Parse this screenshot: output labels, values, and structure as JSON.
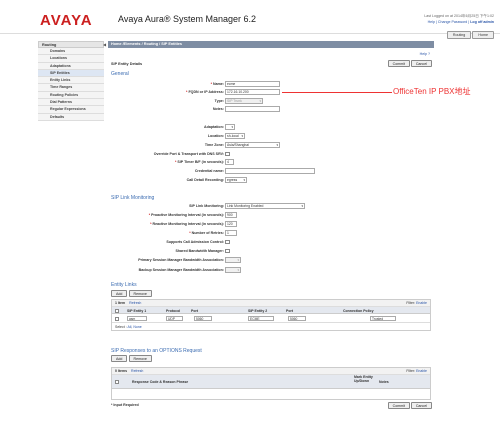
{
  "header": {
    "logo": "AVAYA",
    "app_title": "Avaya Aura® System Manager 6.2",
    "last_logged": "Last Logged on at 2014年6月25日 下午1:02",
    "help_link": "Help",
    "change_password_link": "Change Password",
    "logout_link": "Log off admin",
    "routing_button": "Routing",
    "home_button": "Home",
    "sep1": "|",
    "sep2": "|"
  },
  "nav": {
    "header": "Routing",
    "collapse_glyph": "◀",
    "items": [
      {
        "label": "Domains"
      },
      {
        "label": "Locations"
      },
      {
        "label": "Adaptations"
      },
      {
        "label": "SIP Entities"
      },
      {
        "label": "Entity Links"
      },
      {
        "label": "Time Ranges"
      },
      {
        "label": "Routing Policies"
      },
      {
        "label": "Dial Patterns"
      },
      {
        "label": "Regular Expressions"
      },
      {
        "label": "Defaults"
      }
    ]
  },
  "main": {
    "breadcrumb": "Home /Elements / Routing / SIP Entities",
    "help": "Help ?",
    "commit": "Commit",
    "cancel": "Cancel",
    "subtitle": "SIP Entity Details",
    "general_title": "General",
    "fields": {
      "name": {
        "label": "Name:",
        "value": "ecme"
      },
      "fqdn": {
        "label": "FQDN or IP Address:",
        "value": "172.16.10.200"
      },
      "type": {
        "label": "Type:",
        "value": "SIP Trunk"
      },
      "notes": {
        "label": "Notes:",
        "value": ""
      },
      "adaptation": {
        "label": "Adaptation:",
        "value": ""
      },
      "location": {
        "label": "Location:",
        "value": "sh-local"
      },
      "time_zone": {
        "label": "Time Zone:",
        "value": "Asia/Shanghai"
      },
      "override_port": {
        "label": "Override Port & Transport with DNS SRV:"
      },
      "sip_timer": {
        "label": "SIP Timer B/F (in seconds):",
        "value": "4"
      },
      "credential": {
        "label": "Credential name:",
        "value": ""
      },
      "call_detail": {
        "label": "Call Detail Recording:",
        "value": "egress"
      }
    },
    "required_mark": "*",
    "sip_link_title": "SIP Link Monitoring",
    "link_fields": {
      "monitoring": {
        "label": "SIP Link Monitoring:",
        "value": "Link Monitoring Enabled"
      },
      "proactive": {
        "label": "Proactive Monitoring Interval (in seconds):",
        "value": "900"
      },
      "reactive": {
        "label": "Reactive Monitoring Interval (in seconds):",
        "value": "120"
      },
      "retries": {
        "label": "Number of Retries:",
        "value": "1"
      },
      "cac": {
        "label": "Supports Call Admission Control:"
      },
      "shared_bw": {
        "label": "Shared Bandwidth Manager:"
      },
      "primary_bw": {
        "label": "Primary Session Manager Bandwidth Association:",
        "value": ""
      },
      "backup_bw": {
        "label": "Backup Session Manager Bandwidth Association:",
        "value": ""
      }
    },
    "entity_links": {
      "title": "Entity Links",
      "add": "Add",
      "remove": "Remove",
      "count": "1 Item",
      "refresh": "Refresh",
      "filter_label": "Filter:",
      "filter_link": "Enable",
      "columns": [
        "SIP Entity 1",
        "Protocol",
        "Port",
        "SIP Entity 2",
        "Port",
        "Connection Policy"
      ],
      "row": {
        "entity1": "asm",
        "protocol": "UDP",
        "port1": "5060",
        "entity2": "ECME",
        "port2": "5060",
        "policy": "Trusted"
      },
      "select_label": "Select :",
      "select_all": "All",
      "select_none": "None"
    },
    "sip_responses": {
      "title": "SIP Responses to an OPTIONS Request",
      "add": "Add",
      "remove": "Remove",
      "count": "0 Items",
      "refresh": "Refresh",
      "filter_label": "Filter:",
      "filter_link": "Enable",
      "columns": [
        "Response Code & Reason Phrase",
        "Mark Entity Up/Down",
        "Notes"
      ]
    },
    "input_required": "* Input Required",
    "commit_bottom": "Commit",
    "cancel_bottom": "Cancel"
  },
  "annotation": {
    "text": "OfficeTen IP PBX地址",
    "color": "#e33333"
  }
}
